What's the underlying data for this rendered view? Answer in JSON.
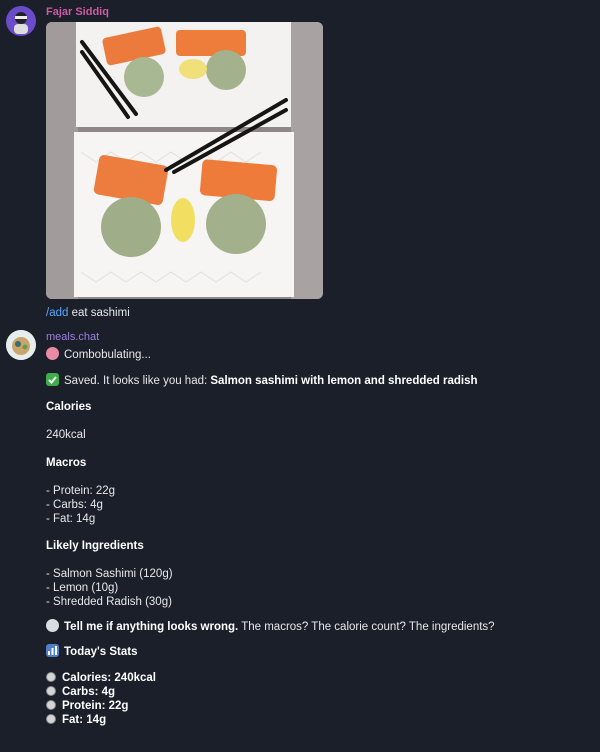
{
  "first_message": {
    "sender": "Fajar Siddiq",
    "command": "/add",
    "text": " eat sashimi",
    "photo_icon": "sashimi-photo"
  },
  "bot_message": {
    "sender": "meals.chat",
    "status": "Combobulating...",
    "saved_prefix": "Saved. It looks like you had: ",
    "saved_food": "Salmon sashimi with lemon and shredded radish",
    "calories_heading": "Calories",
    "calories_value": "240kcal",
    "macros_heading": "Macros",
    "macros": [
      "- Protein: 22g",
      "- Carbs: 4g",
      "- Fat: 14g"
    ],
    "ingredients_heading": "Likely Ingredients",
    "ingredients": [
      "- Salmon Sashimi (120g)",
      "- Lemon (10g)",
      "- Shredded Radish (30g)"
    ],
    "feedback_bold": "Tell me if anything looks wrong.",
    "feedback_rest": " The macros? The calorie count? The ingredients?",
    "stats_heading": "Today's Stats",
    "stats": [
      "Calories: 240kcal",
      "Carbs: 4g",
      "Protein: 22g",
      "Fat: 14g"
    ]
  }
}
